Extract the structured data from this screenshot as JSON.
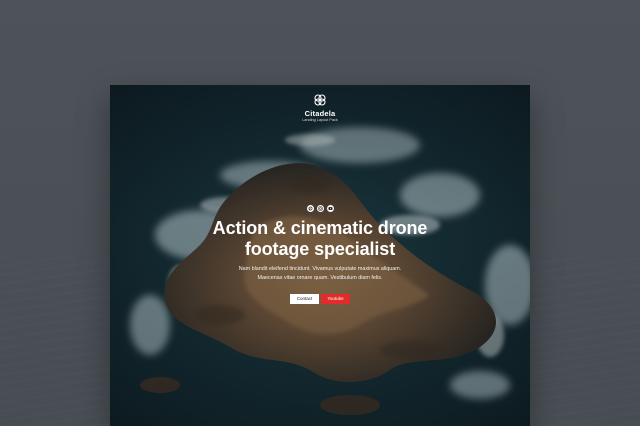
{
  "brand": {
    "name": "Citadela",
    "tagline": "Landing Layout Pack",
    "logo_icon": "flower-logo-icon"
  },
  "socials": [
    {
      "icon": "pinterest-icon"
    },
    {
      "icon": "instagram-icon"
    },
    {
      "icon": "youtube-icon"
    }
  ],
  "hero": {
    "headline_line1": "Action & cinematic drone",
    "headline_line2": "footage specialist",
    "sub_line1": "Nam blandit eleifend tincidunt. Vivamus vulputate maximus aliquam.",
    "sub_line2": "Maecenas vitae ornare quam. Vestibulum diam felis."
  },
  "buttons": {
    "contact_label": "Contact",
    "youtube_label": "Youtube"
  },
  "colors": {
    "backdrop": "#4b5157",
    "youtube_button": "#e22b2b",
    "contact_button": "#ffffff",
    "text": "#ffffff"
  }
}
